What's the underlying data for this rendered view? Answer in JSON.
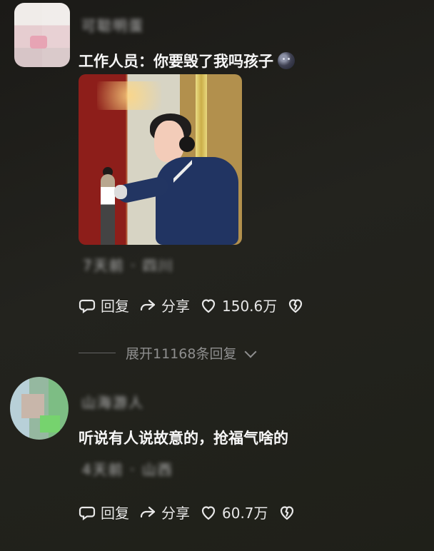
{
  "comments": [
    {
      "username_blurred": "可聪明蛋",
      "text": "工作人员：你要毁了我吗孩子",
      "meta_blurred": "7天前 · 四川",
      "actions": {
        "reply": "回复",
        "share": "分享",
        "likes": "150.6万"
      }
    },
    {
      "username_blurred": "山海游人",
      "text": "听说有人说故意的，抢福气啥的",
      "meta_blurred": "4天前 · 山西",
      "actions": {
        "reply": "回复",
        "share": "分享",
        "likes": "60.7万"
      }
    }
  ],
  "replies": {
    "expand_text": "展开11168条回复"
  },
  "icons": {
    "reply": "reply-icon",
    "share": "share-icon",
    "like": "heart-icon",
    "dislike": "broken-heart-icon",
    "chevron": "chevron-down-icon",
    "emoji": "emoji-icon"
  }
}
